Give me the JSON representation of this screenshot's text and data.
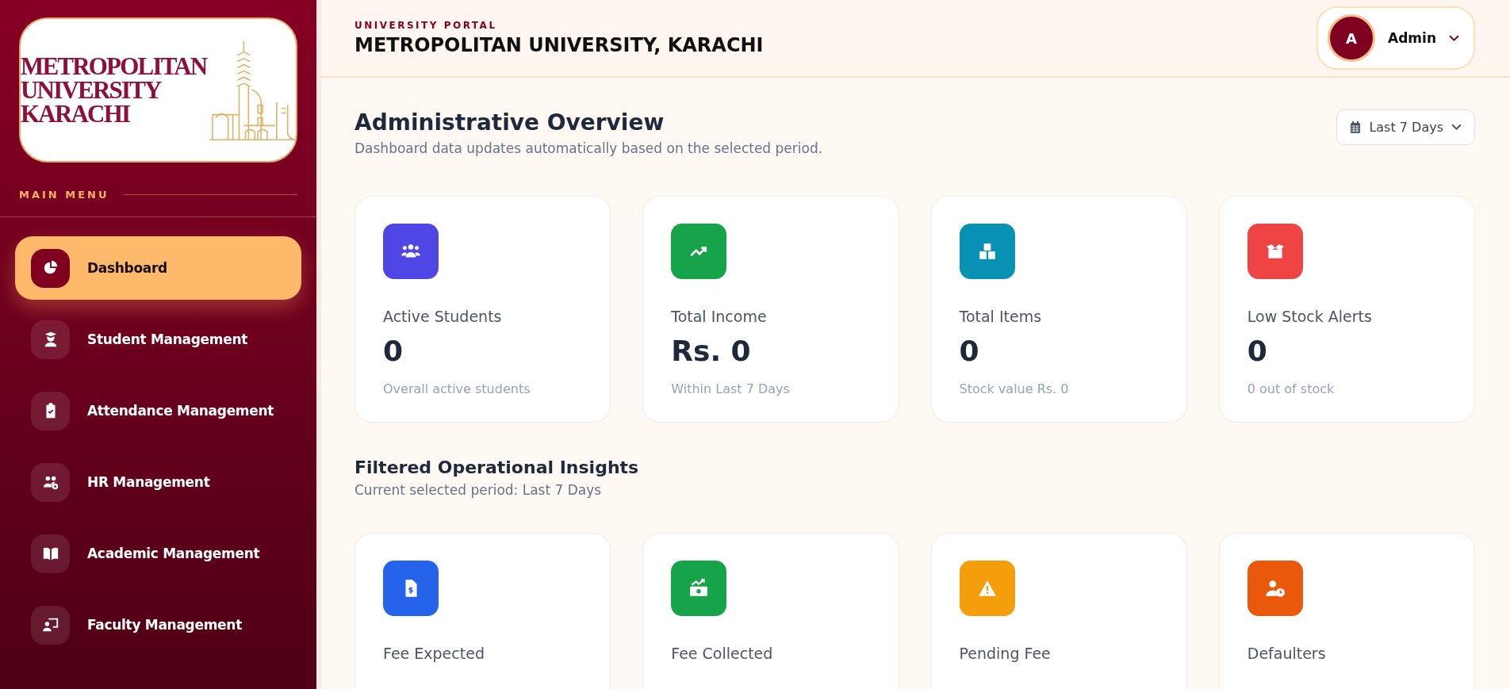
{
  "sidebar": {
    "logo": {
      "lines": [
        "METROPOLITAN",
        "UNIVERSITY",
        "KARACHI"
      ]
    },
    "section_label": "MAIN MENU",
    "items": [
      {
        "label": "Dashboard",
        "selected": true
      },
      {
        "label": "Student Management",
        "selected": false
      },
      {
        "label": "Attendance Management",
        "selected": false
      },
      {
        "label": "HR Management",
        "selected": false
      },
      {
        "label": "Academic Management",
        "selected": false
      },
      {
        "label": "Faculty Management",
        "selected": false
      }
    ]
  },
  "header": {
    "eyebrow": "UNIVERSITY PORTAL",
    "title": "METROPOLITAN UNIVERSITY, KARACHI",
    "user": {
      "initial": "A",
      "name": "Admin"
    }
  },
  "overview": {
    "title": "Administrative Overview",
    "subtitle": "Dashboard data updates automatically based on the selected period.",
    "period": "Last 7 Days",
    "cards": [
      {
        "label": "Active Students",
        "value": "0",
        "note": "Overall active students",
        "color": "#4f46e5"
      },
      {
        "label": "Total Income",
        "value": "Rs. 0",
        "note": "Within Last 7 Days",
        "color": "#16a34a"
      },
      {
        "label": "Total Items",
        "value": "0",
        "note": "Stock value Rs. 0",
        "color": "#0891b2"
      },
      {
        "label": "Low Stock Alerts",
        "value": "0",
        "note": "0 out of stock",
        "color": "#ef4444"
      }
    ]
  },
  "insights": {
    "title": "Filtered Operational Insights",
    "subtitle": "Current selected period: Last 7 Days",
    "cards": [
      {
        "label": "Fee Expected",
        "color": "#2563eb"
      },
      {
        "label": "Fee Collected",
        "color": "#16a34a"
      },
      {
        "label": "Pending Fee",
        "color": "#f59e0b"
      },
      {
        "label": "Defaulters",
        "color": "#ea580c"
      }
    ]
  }
}
